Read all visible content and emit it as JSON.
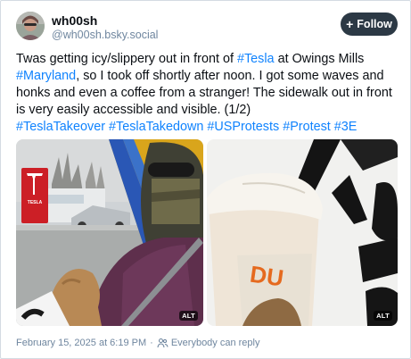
{
  "author": {
    "display_name": "wh00sh",
    "handle": "@wh00sh.bsky.social"
  },
  "follow_button": {
    "label": "Follow",
    "icon": "plus-icon"
  },
  "post": {
    "segments": [
      {
        "text": "Twas getting icy/slippery out in front of ",
        "link": false
      },
      {
        "text": "#Tesla",
        "link": true
      },
      {
        "text": " at Owings Mills ",
        "link": false
      },
      {
        "text": "#Maryland",
        "link": true
      },
      {
        "text": ", so I took off shortly after noon. I got some waves and honks and even a coffee from a stranger! The sidewalk out in front is very easily accessible and visible. (1/2)",
        "link": false
      },
      {
        "text": "\n",
        "link": false,
        "break": true
      },
      {
        "text": "#TeslaTakeover",
        "link": true
      },
      {
        "text": " ",
        "link": false
      },
      {
        "text": "#TeslaTakedown",
        "link": true
      },
      {
        "text": " ",
        "link": false
      },
      {
        "text": "#USProtests",
        "link": true
      },
      {
        "text": " ",
        "link": false
      },
      {
        "text": "#Protest",
        "link": true
      },
      {
        "text": " ",
        "link": false
      },
      {
        "text": "#3E",
        "link": true
      }
    ]
  },
  "media": {
    "left_photo": {
      "alt_badge": "ALT",
      "sign_text": "TESLA"
    },
    "right_photo": {
      "alt_badge": "ALT",
      "cup_text": "DU"
    }
  },
  "footer": {
    "timestamp": "February 15, 2025 at 6:19 PM",
    "separator": "·",
    "reply_setting": "Everybody can reply",
    "reply_icon": "people-icon"
  },
  "colors": {
    "link": "#1083fe",
    "muted": "#6f869f",
    "button_bg": "#2c3945"
  }
}
